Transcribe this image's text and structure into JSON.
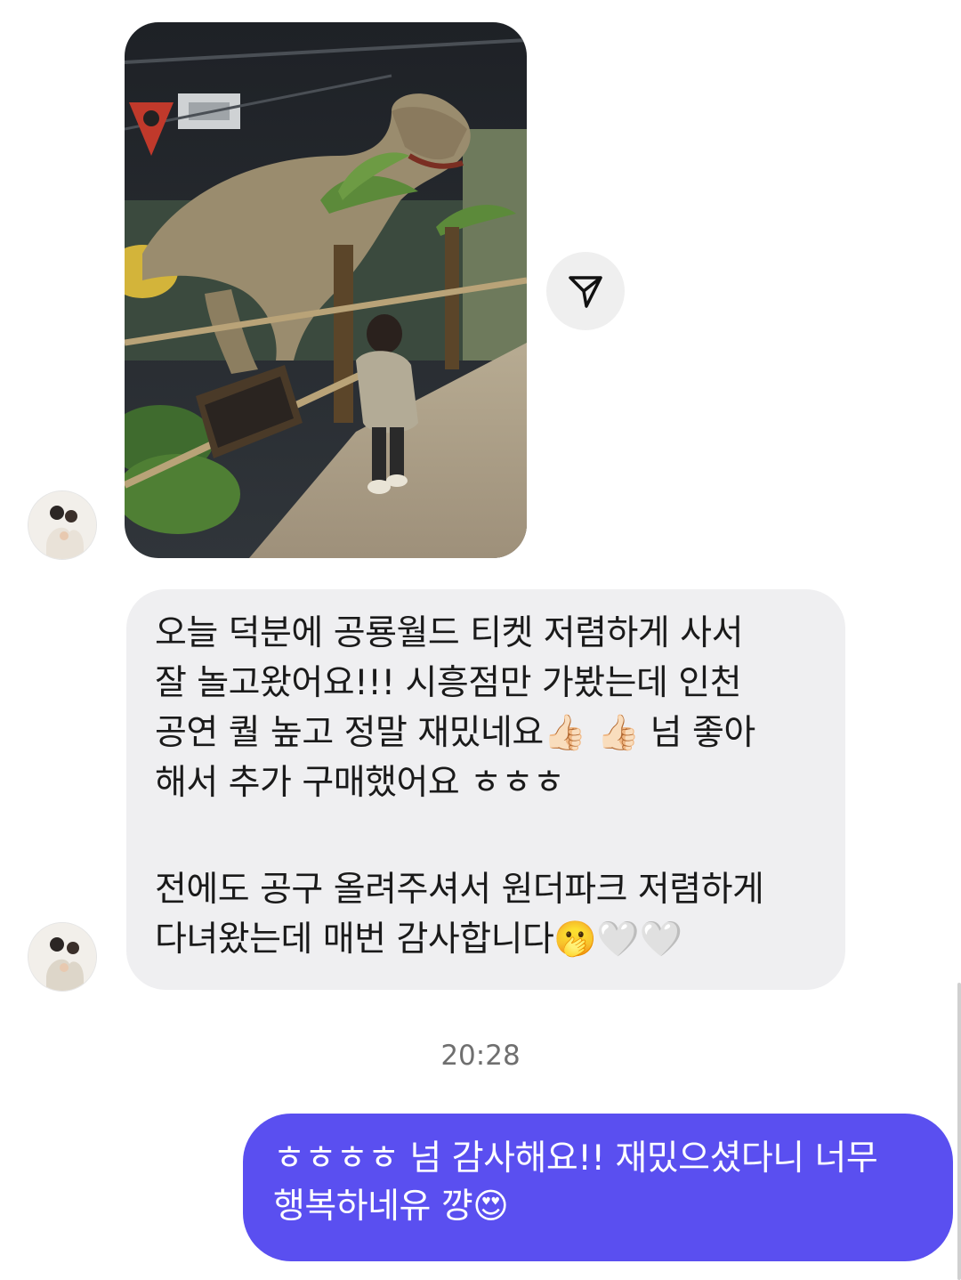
{
  "conversation": {
    "incoming": {
      "photo_alt": "Child at indoor dinosaur park next to a T-rex model",
      "text_lines": [
        "오늘 덕분에 공룡월드 티켓 저렴하게 사서",
        "잘 놀고왔어요!!! 시흥점만 가봤는데 인천",
        "공연 퀄 높고 정말 재밌네요👍🏻 👍🏻  넘 좋아",
        "해서 추가 구매했어요 ㅎㅎㅎ",
        "전에도 공구 올려주셔서 원더파크 저렴하게",
        "다녀왔는데 매번 감사합니다🫢🤍🤍"
      ]
    },
    "timestamp": "20:28",
    "outgoing": {
      "text_lines": [
        "ㅎㅎㅎㅎ 넘 감사해요!! 재밌으셨다니 너무",
        "행복하네유 꺙😍"
      ]
    }
  },
  "icons": {
    "share": "paper-plane-icon",
    "avatar": "profile-photo-avatar"
  },
  "colors": {
    "incoming_bubble": "#efeff1",
    "outgoing_bubble": "#5a4ff0",
    "timestamp": "#6f6f6f",
    "share_button_bg": "#efefef"
  }
}
